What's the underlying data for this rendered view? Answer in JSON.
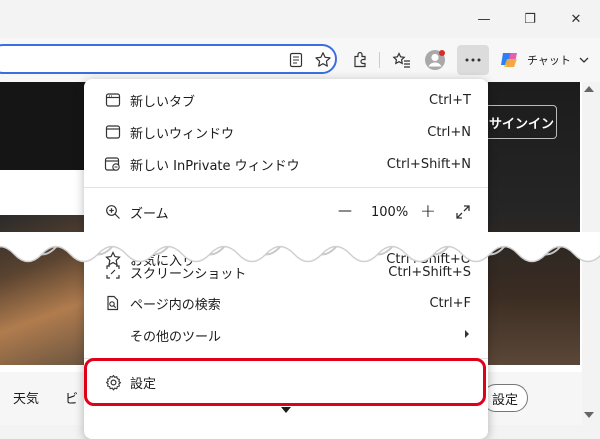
{
  "window": {
    "minimize": "—",
    "restore": "❐",
    "close": "✕"
  },
  "toolbar": {
    "chat_label": "チャット"
  },
  "page": {
    "signin_label": "サインイン",
    "weather_tab": "天気",
    "cut_tab": "ビ",
    "settings_button": "設定"
  },
  "menu": {
    "new_tab": {
      "label": "新しいタブ",
      "shortcut": "Ctrl+T"
    },
    "new_window": {
      "label": "新しいウィンドウ",
      "shortcut": "Ctrl+N"
    },
    "new_inprivate": {
      "label": "新しい InPrivate ウィンドウ",
      "shortcut": "Ctrl+Shift+N"
    },
    "zoom": {
      "label": "ズーム",
      "minus": "—",
      "value": "100%",
      "plus": "+"
    },
    "favorites": {
      "label": "お気に入り",
      "shortcut": "Ctrl+Shift+O"
    },
    "screenshot": {
      "label": "スクリーンショット",
      "shortcut": "Ctrl+Shift+S"
    },
    "find": {
      "label": "ページ内の検索",
      "shortcut": "Ctrl+F"
    },
    "more_tools": {
      "label": "その他のツール"
    },
    "settings": {
      "label": "設定"
    }
  },
  "colors": {
    "highlight": "#e0001a",
    "accent": "#3b6fe0"
  }
}
